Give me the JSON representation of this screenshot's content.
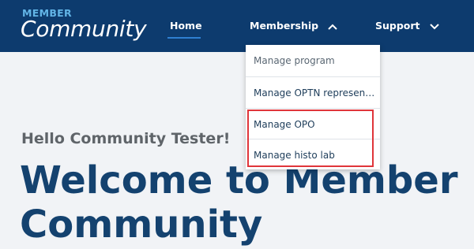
{
  "brand": {
    "small": "MEMBER",
    "large": "Community"
  },
  "nav": {
    "home": "Home",
    "membership": "Membership",
    "support": "Support"
  },
  "dropdown": {
    "items": [
      {
        "label": "Manage program"
      },
      {
        "label": "Manage OPTN represen…"
      },
      {
        "label": "Manage OPO"
      },
      {
        "label": "Manage histo lab"
      }
    ]
  },
  "main": {
    "greeting": "Hello Community Tester!",
    "welcome": "Welcome to Member Community"
  },
  "colors": {
    "header_bg": "#0d3b6e",
    "brand_accent": "#62b4e6",
    "active_underline": "#2f7fd1",
    "highlight_border": "#e0353a",
    "heading": "#14426f"
  },
  "icons": {
    "membership": "chevron-up-icon",
    "support": "chevron-down-icon"
  }
}
